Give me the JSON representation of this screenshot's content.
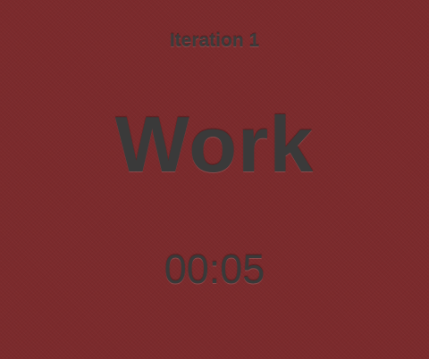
{
  "iteration": {
    "label": "Iteration 1"
  },
  "phase": {
    "label": "Work"
  },
  "timer": {
    "value": "00:05"
  },
  "colors": {
    "background": "#7b2a2c",
    "text": "#3a3a3a"
  }
}
